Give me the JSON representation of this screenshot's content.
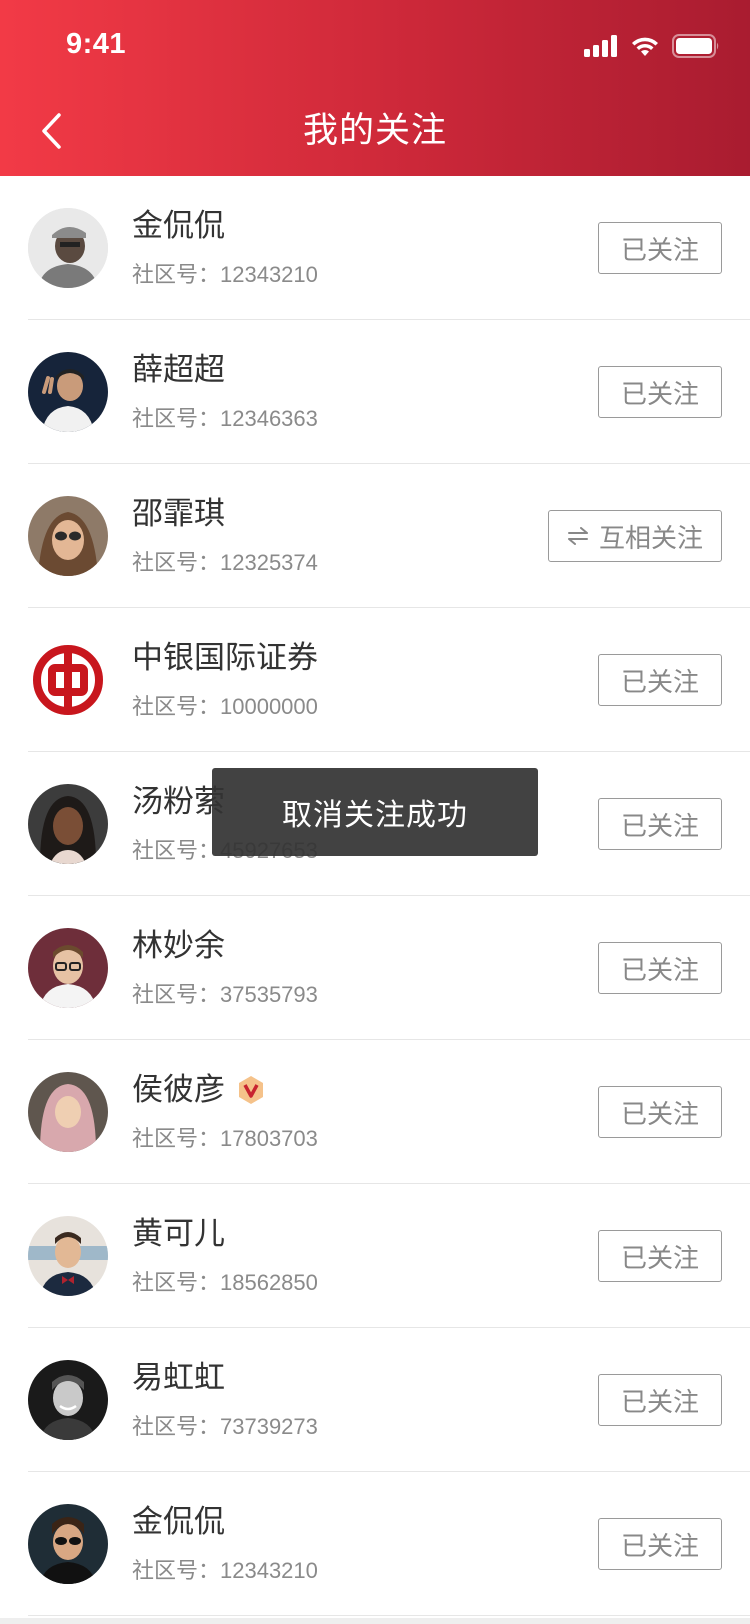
{
  "status_bar": {
    "time": "9:41"
  },
  "header": {
    "title": "我的关注"
  },
  "list": {
    "items": [
      {
        "name": "金侃侃",
        "community_id": "社区号：12343210",
        "button": "已关注",
        "avatar": "avatar-man-cap",
        "mutual": false,
        "vip": false
      },
      {
        "name": "薛超超",
        "community_id": "社区号：12346363",
        "button": "已关注",
        "avatar": "avatar-man-peace",
        "mutual": false,
        "vip": false
      },
      {
        "name": "邵霏琪",
        "community_id": "社区号：12325374",
        "button": "互相关注",
        "avatar": "avatar-woman-sunglasses",
        "mutual": true,
        "vip": false
      },
      {
        "name": "中银国际证券",
        "community_id": "社区号：10000000",
        "button": "已关注",
        "avatar": "bank-of-china-logo",
        "mutual": false,
        "vip": false
      },
      {
        "name": "汤粉萦",
        "community_id": "社区号：45927653",
        "button": "已关注",
        "avatar": "avatar-woman",
        "mutual": false,
        "vip": false
      },
      {
        "name": "林妙余",
        "community_id": "社区号：37535793",
        "button": "已关注",
        "avatar": "avatar-man-glasses",
        "mutual": false,
        "vip": false
      },
      {
        "name": "侯彼彦",
        "community_id": "社区号：17803703",
        "button": "已关注",
        "avatar": "avatar-woman-hijab",
        "mutual": false,
        "vip": true
      },
      {
        "name": "黄可儿",
        "community_id": "社区号：18562850",
        "button": "已关注",
        "avatar": "avatar-man-bowtie",
        "mutual": false,
        "vip": false
      },
      {
        "name": "易虹虹",
        "community_id": "社区号：73739273",
        "button": "已关注",
        "avatar": "avatar-man-smile",
        "mutual": false,
        "vip": false
      },
      {
        "name": "金侃侃",
        "community_id": "社区号：12343210",
        "button": "已关注",
        "avatar": "avatar-man-sunglasses",
        "mutual": false,
        "vip": false
      }
    ]
  },
  "toast": {
    "text": "取消关注成功"
  },
  "colors": {
    "header_start": "#f23a46",
    "header_end": "#a91c30",
    "vip_badge": "#f5c28a",
    "vip_v": "#c8242f"
  }
}
